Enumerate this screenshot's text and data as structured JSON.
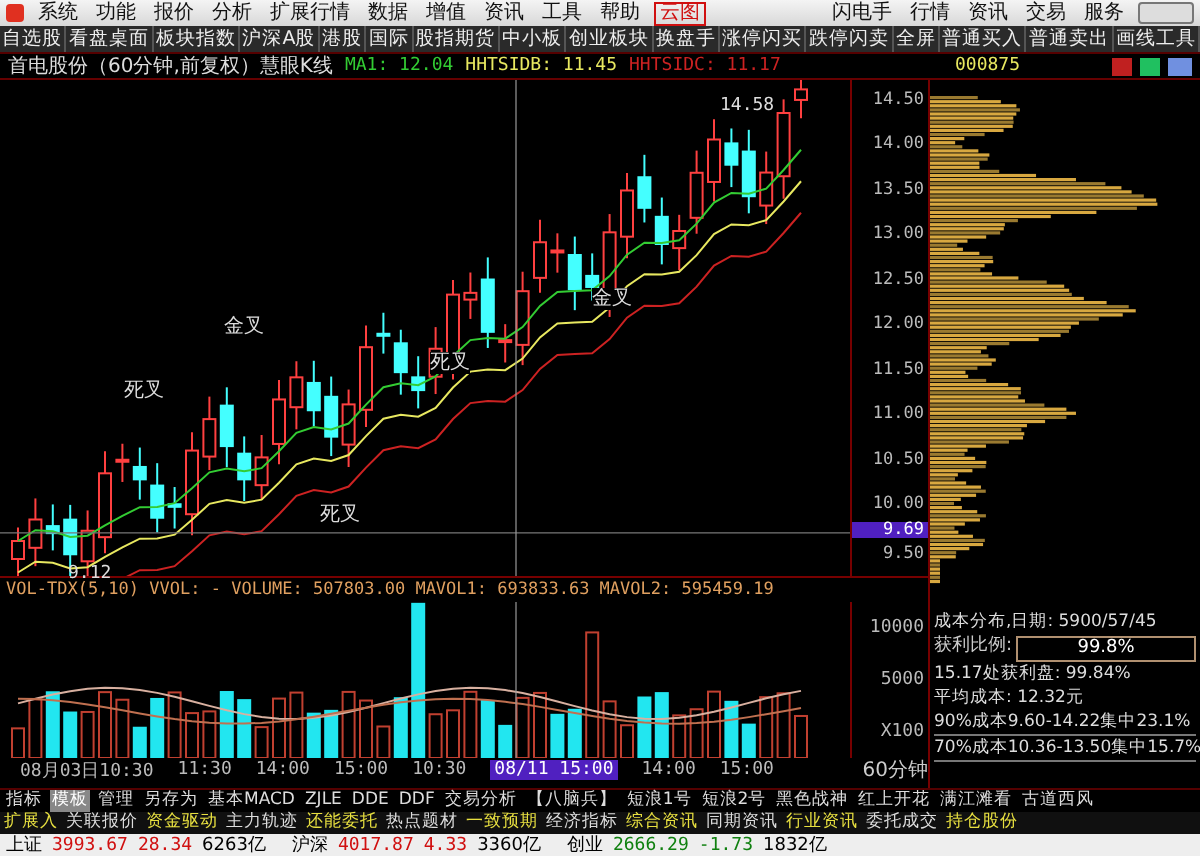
{
  "menu_bar": {
    "items": [
      {
        "label": "系统",
        "kind": "plain"
      },
      {
        "label": "功能",
        "kind": "plain"
      },
      {
        "label": "报价",
        "kind": "plain"
      },
      {
        "label": "分析",
        "kind": "plain"
      },
      {
        "label": "扩展行情",
        "kind": "plain"
      },
      {
        "label": "数据",
        "kind": "plain"
      },
      {
        "label": "增值",
        "kind": "plain"
      },
      {
        "label": "资讯",
        "kind": "plain"
      },
      {
        "label": "工具",
        "kind": "plain"
      },
      {
        "label": "帮助",
        "kind": "plain"
      },
      {
        "label": "云图",
        "kind": "boxed"
      }
    ],
    "right_items": [
      "闪电手",
      "行情",
      "资讯",
      "交易",
      "服务"
    ]
  },
  "toolbar": {
    "items": [
      "自选股",
      "看盘桌面",
      "板块指数",
      "沪深A股",
      "港股",
      "国际",
      "股指期货",
      "中小板",
      "创业板块",
      "换盘手",
      "涨停闪买",
      "跌停闪卖",
      "全屏",
      "普通买入",
      "普通卖出",
      "画线工具"
    ]
  },
  "chart_header": {
    "title": "首电股份（60分钟,前复权）慧眼K线",
    "indicators": [
      {
        "text": "MA1: 12.04",
        "color": "#33cc33"
      },
      {
        "text": "HHTSIDB: 11.45",
        "color": "#e8e860"
      },
      {
        "text": "HHTSIDC: 11.17",
        "color": "#cc2222"
      }
    ],
    "code": "000875"
  },
  "price_chart": {
    "y_labels": [
      "14.50",
      "14.00",
      "13.50",
      "13.00",
      "12.50",
      "12.00",
      "11.50",
      "11.00",
      "10.50",
      "10.00",
      "9.50"
    ],
    "cursor_price": "9.69",
    "high_label": "14.58",
    "low_label": "9.12",
    "signals": [
      "死叉",
      "金叉",
      "死叉",
      "金叉",
      "死叉"
    ]
  },
  "volume_chart": {
    "header": "VOL-TDX(5,10) VVOL: - VOLUME: 507803.00 MAVOL1: 693833.63 MAVOL2: 595459.19",
    "y_labels": [
      "10000",
      "5000",
      "X100"
    ]
  },
  "time_axis": {
    "labels": [
      {
        "text": "08月03日10:30",
        "selected": false
      },
      {
        "text": "11:30",
        "selected": false
      },
      {
        "text": "14:00",
        "selected": false
      },
      {
        "text": "15:00",
        "selected": false
      },
      {
        "text": "10:30",
        "selected": false
      },
      {
        "text": "08/11 15:00",
        "selected": true
      },
      {
        "text": "14:00",
        "selected": false
      },
      {
        "text": "15:00",
        "selected": false
      }
    ],
    "period": "60分钟"
  },
  "indicator_tabs": [
    {
      "label": "指标",
      "selected": false
    },
    {
      "label": "模板",
      "selected": true
    },
    {
      "label": "管理",
      "selected": false
    },
    {
      "label": "另存为",
      "selected": false
    },
    {
      "label": "基本MACD",
      "selected": false
    },
    {
      "label": "ZJLE",
      "selected": false
    },
    {
      "label": "DDE",
      "selected": false
    },
    {
      "label": "DDF",
      "selected": false
    },
    {
      "label": "交易分析",
      "selected": false
    },
    {
      "label": "【八脑兵】",
      "selected": false
    },
    {
      "label": "短浪1号",
      "selected": false
    },
    {
      "label": "短浪2号",
      "selected": false
    },
    {
      "label": "黑色战神",
      "selected": false
    },
    {
      "label": "红上开花",
      "selected": false
    },
    {
      "label": "满江滩看",
      "selected": false
    },
    {
      "label": "古道西风",
      "selected": false
    }
  ],
  "info_tabs": [
    "扩展入",
    "关联报价",
    "资金驱动",
    "主力轨迹",
    "还能委托",
    "热点题材",
    "一致预期",
    "经济指标",
    "综合资讯",
    "同期资讯",
    "行业资讯",
    "委托成交",
    "持仓股份"
  ],
  "cost_panel": {
    "title": "成本分布,日期: 5900/57/45",
    "profit_label": "获利比例:",
    "profit_value": "99.8%",
    "lines": [
      "15.17处获利盘: 99.84%",
      "平均成本:  12.32元",
      "90%成本9.60-14.22集中23.1%",
      "70%成本10.36-13.50集中15.7%"
    ]
  },
  "status_bar": {
    "indices": [
      {
        "name": "上证",
        "value": "3993.67",
        "change": "28.34",
        "amount": "6263亿"
      },
      {
        "name": "沪深",
        "value": "4017.87",
        "change": "4.33",
        "amount": "3360亿"
      },
      {
        "name": "创业",
        "value": "2666.29",
        "change": "-1.73",
        "amount": "1832亿"
      }
    ]
  }
}
